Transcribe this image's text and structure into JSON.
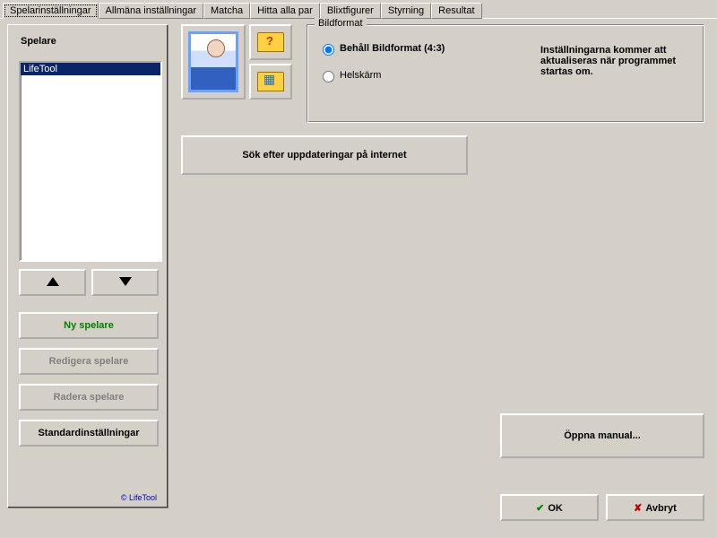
{
  "tabs": [
    "Spelarinställningar",
    "Allmäna inställningar",
    "Matcha",
    "Hitta alla par",
    "Blixtfigurer",
    "Styrning",
    "Resultat"
  ],
  "active_tab_index": 0,
  "left": {
    "title": "Spelare",
    "items": [
      "LifeTool"
    ],
    "btn_new": "Ny spelare",
    "btn_edit": "Redigera spelare",
    "btn_delete": "Radera spelare",
    "btn_defaults": "Standardinställningar",
    "copyright": "© LifeTool"
  },
  "group": {
    "legend": "Bildformat",
    "opt_keep": "Behåll Bildformat (4:3)",
    "opt_full": "Helskärm",
    "selected": "keep",
    "note": "Inställningarna kommer att aktualiseras när programmet startas om."
  },
  "buttons": {
    "search_updates": "Sök efter uppdateringar på internet",
    "open_manual": "Öppna manual...",
    "ok": "OK",
    "cancel": "Avbryt"
  }
}
